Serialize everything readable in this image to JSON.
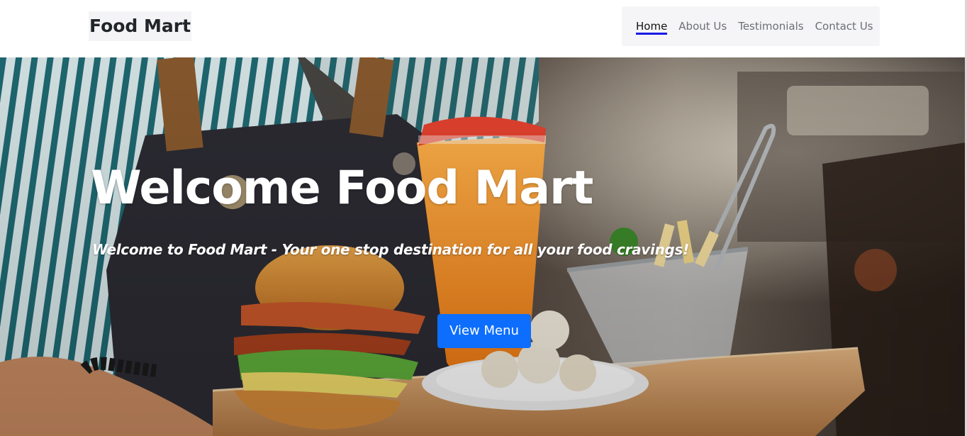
{
  "navbar": {
    "brand": "Food Mart",
    "links": [
      {
        "label": "Home",
        "active": true
      },
      {
        "label": "About Us",
        "active": false
      },
      {
        "label": "Testimonials",
        "active": false
      },
      {
        "label": "Contact Us",
        "active": false
      }
    ]
  },
  "hero": {
    "title": "Welcome Food Mart",
    "subtitle": "Welcome to Food Mart - Your one stop destination for all your food cravings!",
    "button_label": "View Menu",
    "background_icon": "food-tray-photo"
  },
  "colors": {
    "accent": "#0d6efd",
    "active_underline": "#1a1ae6",
    "nav_background": "#f5f5f7"
  }
}
